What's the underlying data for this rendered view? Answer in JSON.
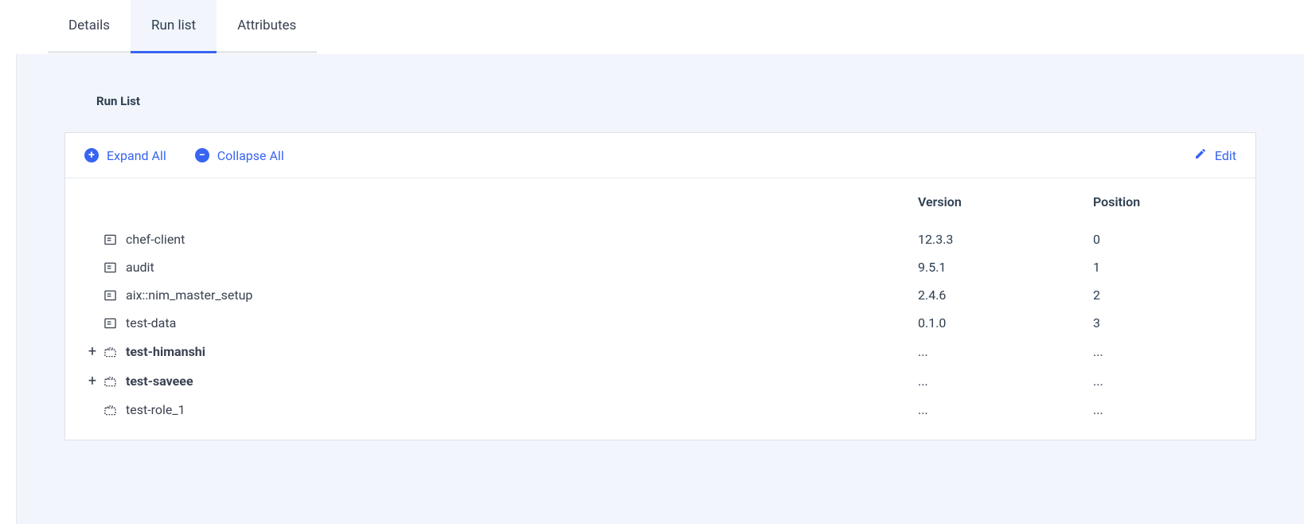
{
  "tabs": [
    {
      "label": "Details",
      "active": false
    },
    {
      "label": "Run list",
      "active": true
    },
    {
      "label": "Attributes",
      "active": false
    }
  ],
  "section_title": "Run List",
  "toolbar": {
    "expand_all": "Expand All",
    "collapse_all": "Collapse All",
    "edit": "Edit"
  },
  "columns": {
    "version": "Version",
    "position": "Position"
  },
  "rows": [
    {
      "type": "recipe",
      "name": "chef-client",
      "version": "12.3.3",
      "position": "0",
      "expandable": false
    },
    {
      "type": "recipe",
      "name": "audit",
      "version": "9.5.1",
      "position": "1",
      "expandable": false
    },
    {
      "type": "recipe",
      "name": "aix::nim_master_setup",
      "version": "2.4.6",
      "position": "2",
      "expandable": false
    },
    {
      "type": "recipe",
      "name": "test-data",
      "version": "0.1.0",
      "position": "3",
      "expandable": false
    },
    {
      "type": "role",
      "name": "test-himanshi",
      "version": "...",
      "position": "...",
      "expandable": true
    },
    {
      "type": "role",
      "name": "test-saveee",
      "version": "...",
      "position": "...",
      "expandable": true
    },
    {
      "type": "role",
      "name": "test-role_1",
      "version": "...",
      "position": "...",
      "expandable": false
    }
  ]
}
